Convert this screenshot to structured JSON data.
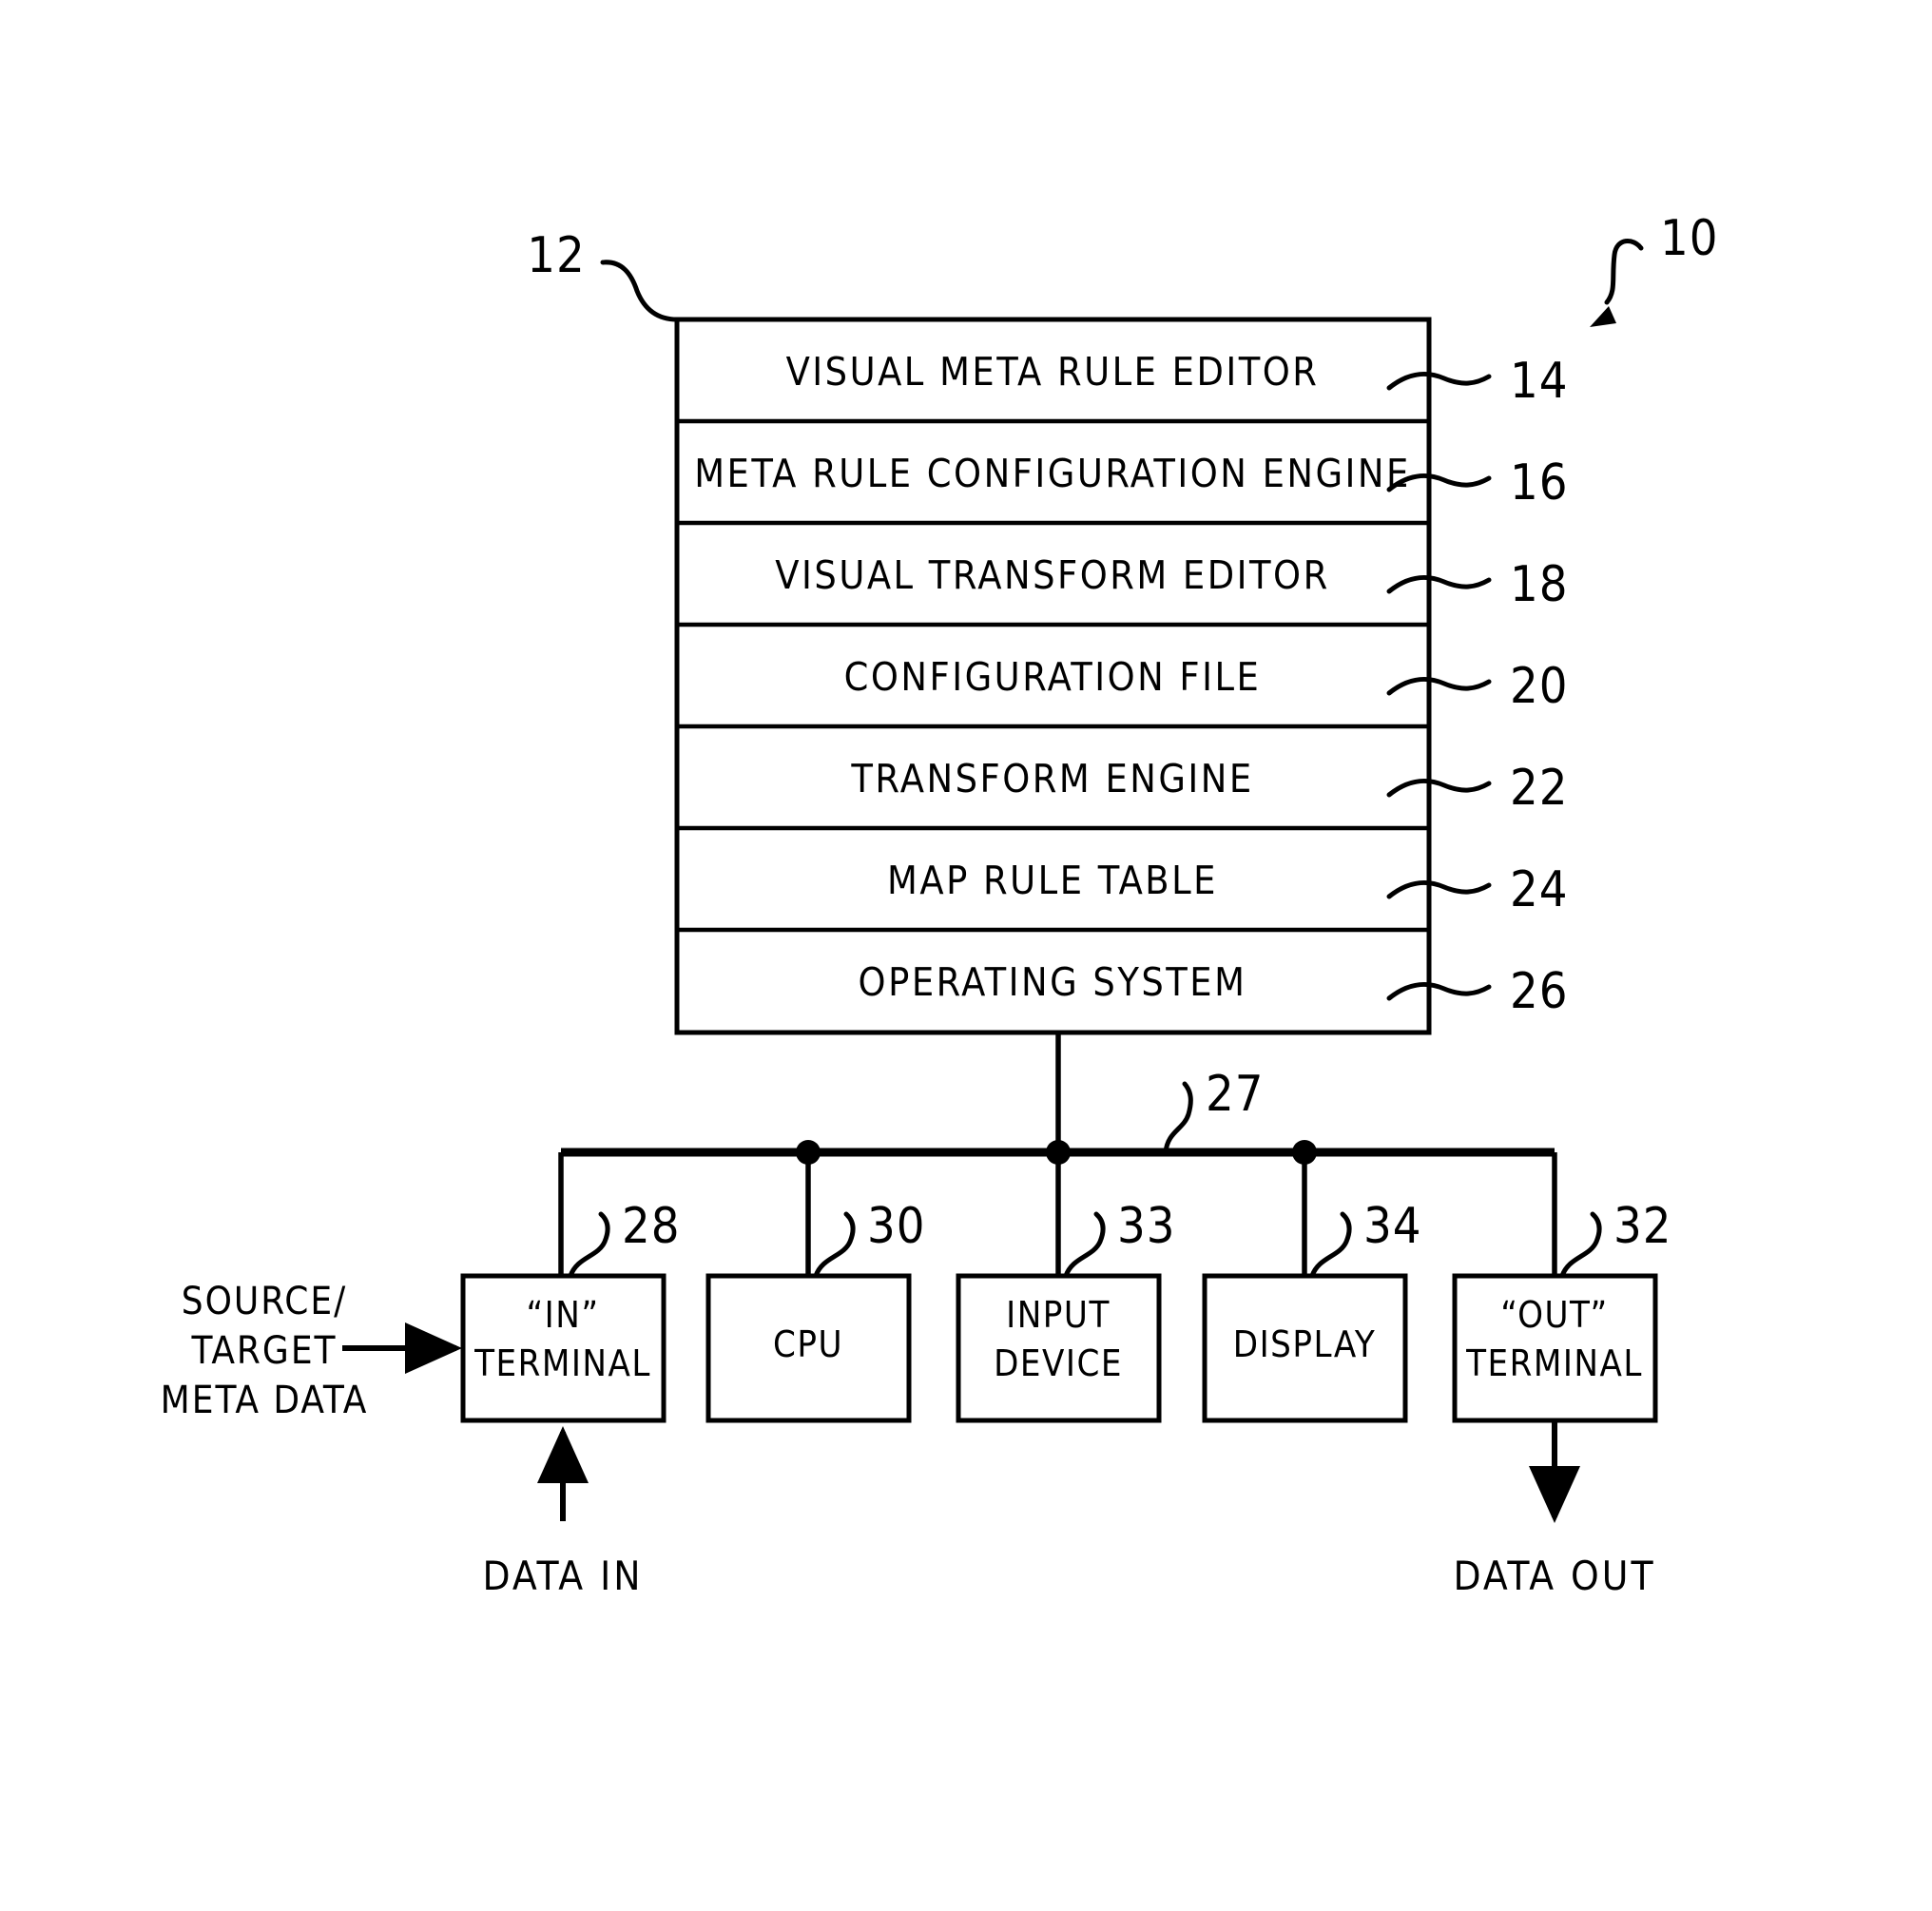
{
  "figure": {
    "overall_ref": "10",
    "system_ref": "12",
    "bus_ref": "27"
  },
  "stack": {
    "rows": [
      {
        "label": "VISUAL META RULE EDITOR",
        "ref": "14"
      },
      {
        "label": "META RULE CONFIGURATION ENGINE",
        "ref": "16"
      },
      {
        "label": "VISUAL TRANSFORM EDITOR",
        "ref": "18"
      },
      {
        "label": "CONFIGURATION FILE",
        "ref": "20"
      },
      {
        "label": "TRANSFORM ENGINE",
        "ref": "22"
      },
      {
        "label": "MAP RULE TABLE",
        "ref": "24"
      },
      {
        "label": "OPERATING SYSTEM",
        "ref": "26"
      }
    ]
  },
  "devices": [
    {
      "line1": "“IN”",
      "line2": "TERMINAL",
      "ref": "28"
    },
    {
      "line1": "CPU",
      "line2": "",
      "ref": "30"
    },
    {
      "line1": "INPUT",
      "line2": "DEVICE",
      "ref": "33"
    },
    {
      "line1": "DISPLAY",
      "line2": "",
      "ref": "34"
    },
    {
      "line1": "“OUT”",
      "line2": "TERMINAL",
      "ref": "32"
    }
  ],
  "annotations": {
    "source_target_line1": "SOURCE/",
    "source_target_line2": "TARGET",
    "source_target_line3": "META DATA",
    "data_in": "DATA IN",
    "data_out": "DATA OUT"
  },
  "colors": {
    "ink": "#000000",
    "paper": "#ffffff"
  }
}
